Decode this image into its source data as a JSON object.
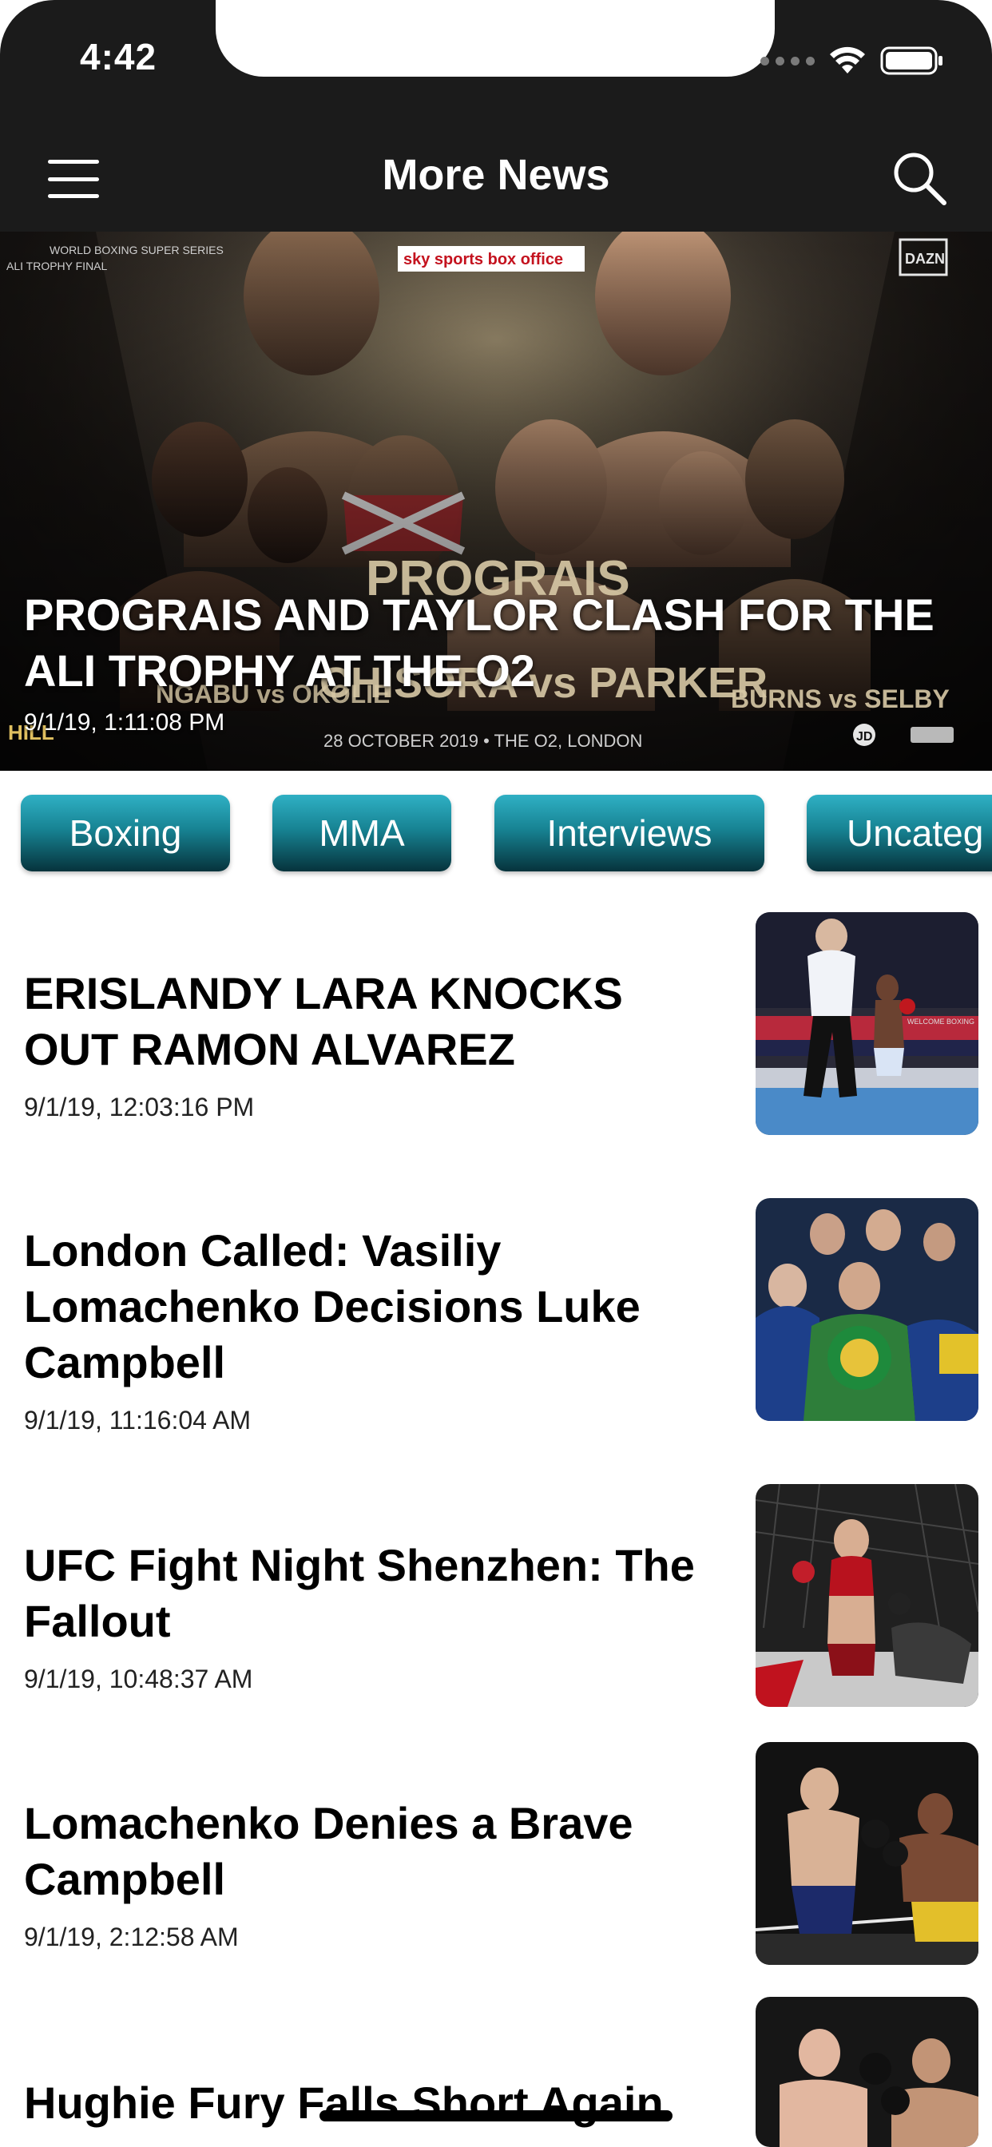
{
  "status_bar": {
    "time": "4:42"
  },
  "nav": {
    "title": "More News"
  },
  "hero": {
    "title": "PROGRAIS AND TAYLOR CLASH FOR THE ALI TROPHY AT THE O2",
    "date": "9/1/19, 1:11:08 PM",
    "poster": {
      "top_left": "WORLD BOXING SUPER SERIES",
      "top_left_sub": "ALI TROPHY FINAL",
      "brand": "sky sports box office",
      "top_right": "DAZN",
      "headline_1": "PROGRAIS",
      "headline_2": "CHISORA vs PARKER",
      "left_names": "NGABU vs OKOLIE",
      "right_names": "BURNS vs SELBY",
      "event": "28 OCTOBER 2019 • THE O2, LONDON",
      "sponsor_left": "HILL",
      "sponsor_right": "JD"
    }
  },
  "categories": [
    "Boxing",
    "MMA",
    "Interviews",
    "Uncateg"
  ],
  "news": [
    {
      "title": "ERISLANDY LARA KNOCKS OUT RAMON ALVAREZ",
      "date": "9/1/19, 12:03:16 PM"
    },
    {
      "title": "London Called: Vasiliy Lomachenko Decisions Luke Campbell",
      "date": "9/1/19, 11:16:04 AM"
    },
    {
      "title": "UFC Fight Night Shenzhen: The Fallout",
      "date": "9/1/19, 10:48:37 AM"
    },
    {
      "title": "Lomachenko Denies a Brave Campbell",
      "date": "9/1/19, 2:12:58 AM"
    },
    {
      "title": "Hughie Fury Falls Short Again",
      "date": ""
    }
  ],
  "colors": {
    "header_bg": "#1b1b1b",
    "chip_top": "#2fb0c4",
    "chip_bottom": "#06333c"
  }
}
